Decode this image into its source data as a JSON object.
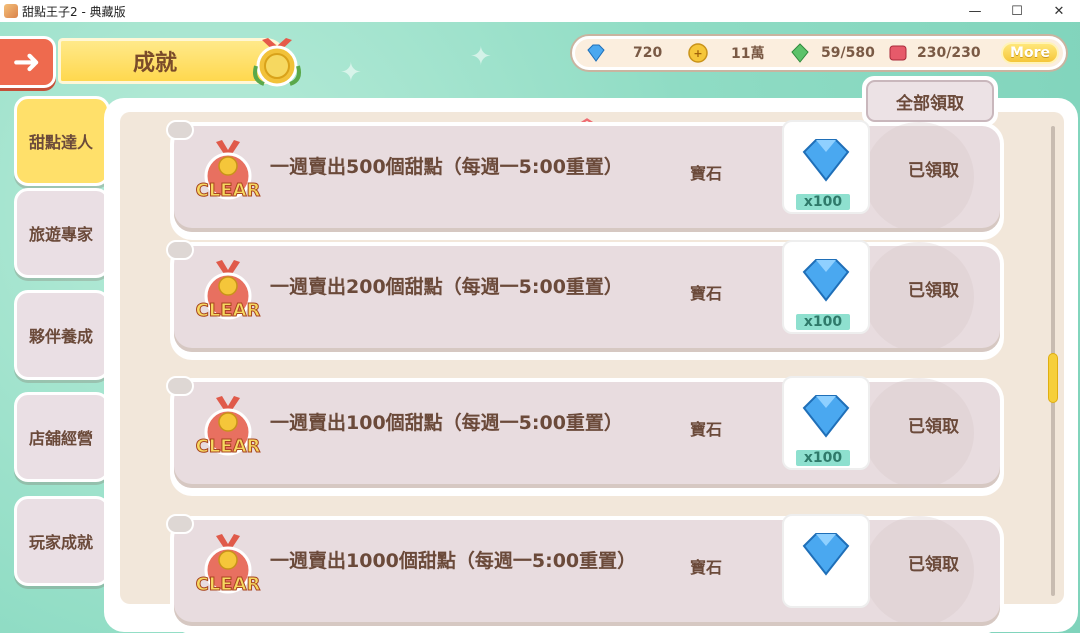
{
  "window": {
    "title": "甜點王子2 - 典藏版",
    "minimize": "—",
    "maximize": "☐",
    "close": "✕"
  },
  "header": {
    "title": "成就"
  },
  "resources": {
    "gems": "720",
    "coins": "11萬",
    "stamina": "59/580",
    "tickets": "230/230",
    "more_label": "More"
  },
  "claim_all_label": "全部領取",
  "nav": [
    {
      "label": "甜點達人",
      "active": true
    },
    {
      "label": "旅遊專家",
      "active": false
    },
    {
      "label": "夥伴養成",
      "active": false
    },
    {
      "label": "店舖經營",
      "active": false
    },
    {
      "label": "玩家成就",
      "active": false
    }
  ],
  "achievements": [
    {
      "title": "一週賣出500個甜點（每週一5:00重置）",
      "reward_type": "寶石",
      "qty": "x100",
      "status": "已領取"
    },
    {
      "title": "一週賣出200個甜點（每週一5:00重置）",
      "reward_type": "寶石",
      "qty": "x100",
      "status": "已領取"
    },
    {
      "title": "一週賣出100個甜點（每週一5:00重置）",
      "reward_type": "寶石",
      "qty": "x100",
      "status": "已領取"
    },
    {
      "title": "一週賣出1000個甜點（每週一5:00重置）",
      "reward_type": "寶石",
      "qty": "",
      "status": "已領取"
    }
  ],
  "badge_text": "CLEAR",
  "colors": {
    "accent": "#ee6a4e",
    "bg": "#8fdcc4",
    "gem": "#4aa8f0"
  }
}
